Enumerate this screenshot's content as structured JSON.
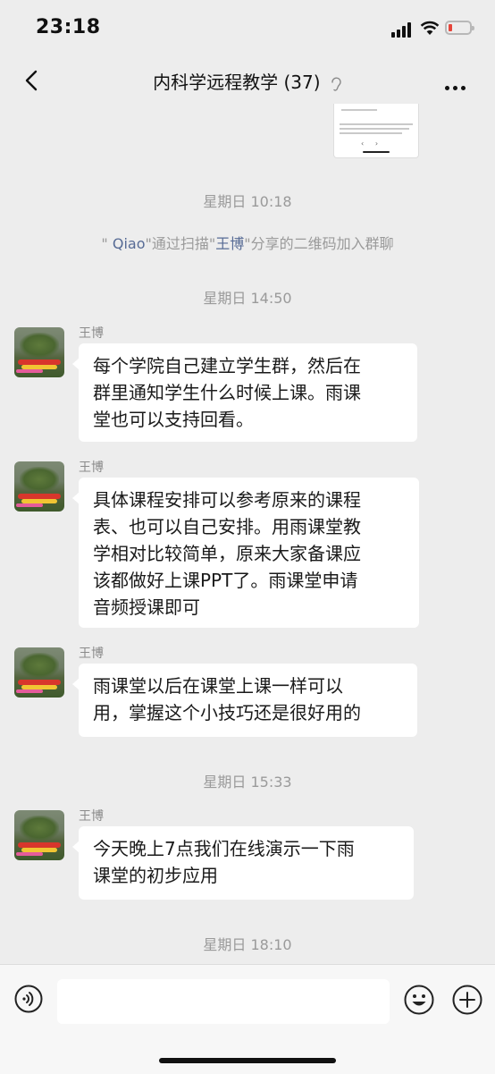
{
  "status_bar": {
    "time": "23:18"
  },
  "header": {
    "title": "内科学远程教学 (37)"
  },
  "messages": [
    {
      "type": "timestamp",
      "text": "星期日 10:18"
    },
    {
      "type": "system",
      "parts": [
        "\" ",
        "Qiao",
        "\"通过扫描\"",
        "王博",
        "\"分享的二维码加入群聊"
      ]
    },
    {
      "type": "timestamp",
      "text": "星期日 14:50"
    },
    {
      "type": "chat",
      "sender": "王博",
      "lines": [
        "每个学院自己建立学生群，然后在",
        "群里通知学生什么时候上课。雨课",
        "堂也可以支持回看。"
      ]
    },
    {
      "type": "chat",
      "sender": "王博",
      "lines": [
        "具体课程安排可以参考原来的课程",
        "表、也可以自己安排。用雨课堂教",
        "学相对比较简单，原来大家备课应",
        "该都做好上课PPT了。雨课堂申请",
        "音频授课即可"
      ]
    },
    {
      "type": "chat",
      "sender": "王博",
      "lines": [
        "雨课堂以后在课堂上课一样可以",
        "用，掌握这个小技巧还是很好用的"
      ]
    },
    {
      "type": "timestamp",
      "text": "星期日 15:33"
    },
    {
      "type": "chat",
      "sender": "王博",
      "lines": [
        "今天晚上7点我们在线演示一下雨",
        "课堂的初步应用"
      ]
    },
    {
      "type": "timestamp",
      "text": "星期日 18:10"
    }
  ],
  "input_bar": {
    "placeholder": ""
  },
  "icons": {
    "back": "chevron-left-icon",
    "more": "more-icon",
    "voice": "voice-icon",
    "emoji": "emoji-icon",
    "plus": "plus-icon",
    "ear": "ear-icon"
  },
  "colors": {
    "background": "#ededed",
    "bubble": "#ffffff",
    "link": "#576b95",
    "meta_text": "#9a9a9a",
    "battery_low": "#e6453a"
  }
}
